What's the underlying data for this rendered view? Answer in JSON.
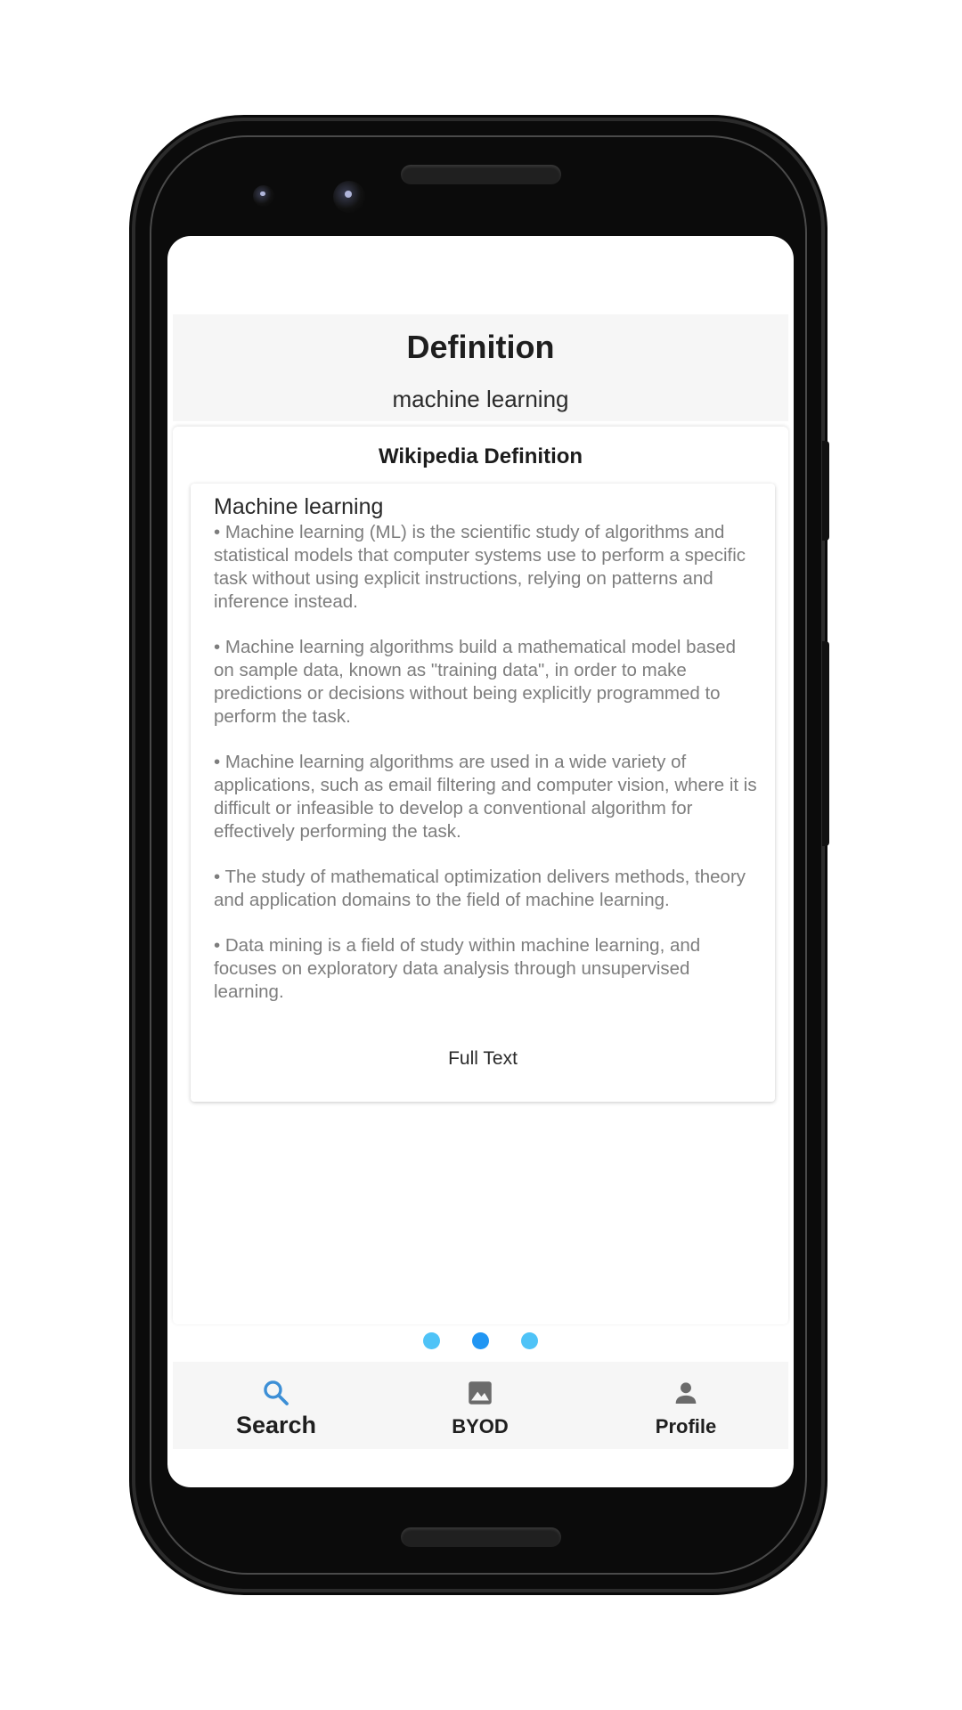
{
  "header": {
    "title": "Definition",
    "subtitle": "machine learning"
  },
  "card": {
    "title": "Wikipedia Definition",
    "article_heading": "Machine learning",
    "bullets": [
      "• Machine learning (ML) is the scientific study of algorithms and statistical models that computer systems use to perform a specific task without using explicit instructions, relying on patterns and inference instead.",
      "• Machine learning algorithms build a mathematical model based on sample data, known as \"training data\", in order to make predictions or decisions without being explicitly programmed to perform the task.",
      "• Machine learning algorithms are used in a wide variety of applications, such as email filtering and computer vision, where it is difficult or infeasible to develop a conventional algorithm for effectively performing the task.",
      "• The study of mathematical optimization delivers methods, theory and application domains to the field of machine learning.",
      "• Data mining is a field of study within machine learning, and focuses on exploratory data analysis through unsupervised learning."
    ],
    "full_text_label": "Full Text"
  },
  "pager": {
    "count": 3,
    "active_index": 1,
    "active_color": "#2196f3",
    "inactive_color": "#4fc3f7"
  },
  "nav": {
    "items": [
      {
        "label": "Search",
        "icon": "search-icon",
        "active": true
      },
      {
        "label": "BYOD",
        "icon": "image-icon",
        "active": false
      },
      {
        "label": "Profile",
        "icon": "person-icon",
        "active": false
      }
    ],
    "active_color": "#3d8fd6",
    "inactive_color": "#6b6b6b"
  }
}
